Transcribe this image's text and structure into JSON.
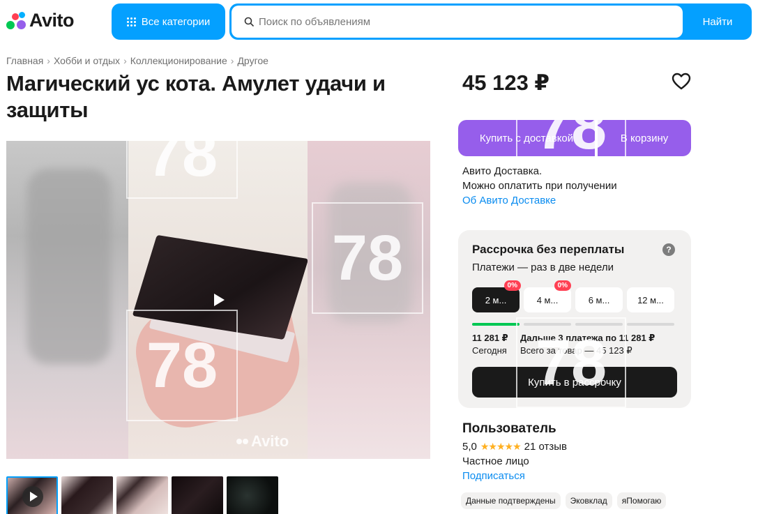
{
  "header": {
    "logo_text": "Avito",
    "categories_label": "Все категории",
    "search_placeholder": "Поиск по объявлениям",
    "search_button": "Найти"
  },
  "breadcrumb": [
    "Главная",
    "Хобби и отдых",
    "Коллекционирование",
    "Другое"
  ],
  "listing": {
    "title": "Магический ус кота. Амулет удачи и защиты",
    "price": "45 123 ₽",
    "watermark": "78",
    "gallery_watermark": "Avito"
  },
  "actions": {
    "buy_delivery": "Купить с доставкой",
    "add_to_cart": "В корзину"
  },
  "delivery": {
    "line1": "Авито Доставка.",
    "line2": "Можно оплатить при получении",
    "link": "Об Авито Доставке"
  },
  "installment": {
    "title": "Рассрочка без переплаты",
    "subtitle": "Платежи — раз в две недели",
    "help": "?",
    "terms": [
      {
        "label": "2 м...",
        "badge": "0%"
      },
      {
        "label": "4 м...",
        "badge": "0%"
      },
      {
        "label": "6 м...",
        "badge": ""
      },
      {
        "label": "12 м...",
        "badge": ""
      }
    ],
    "progress_filled_segments": 1,
    "first_amount": "11 281 ₽",
    "first_when": "Сегодня",
    "next_text": "Дальше 3 платежа по 11 281 ₽",
    "total_text": "Всего за товар — 45 123 ₽",
    "button": "Купить в рассрочку"
  },
  "seller": {
    "name": "Пользователь",
    "rating": "5,0",
    "stars": "★★★★★",
    "reviews": "21 отзыв",
    "type": "Частное лицо",
    "subscribe": "Подписаться",
    "badges": [
      "Данные подтверждены",
      "Эковклад",
      "яПомогаю"
    ]
  },
  "colors": {
    "accent_blue": "#04a0ff",
    "purple": "#965eeb",
    "link": "#0a8cf0",
    "badge_red": "#ff4053",
    "green": "#00c853",
    "star": "#ffb021"
  }
}
